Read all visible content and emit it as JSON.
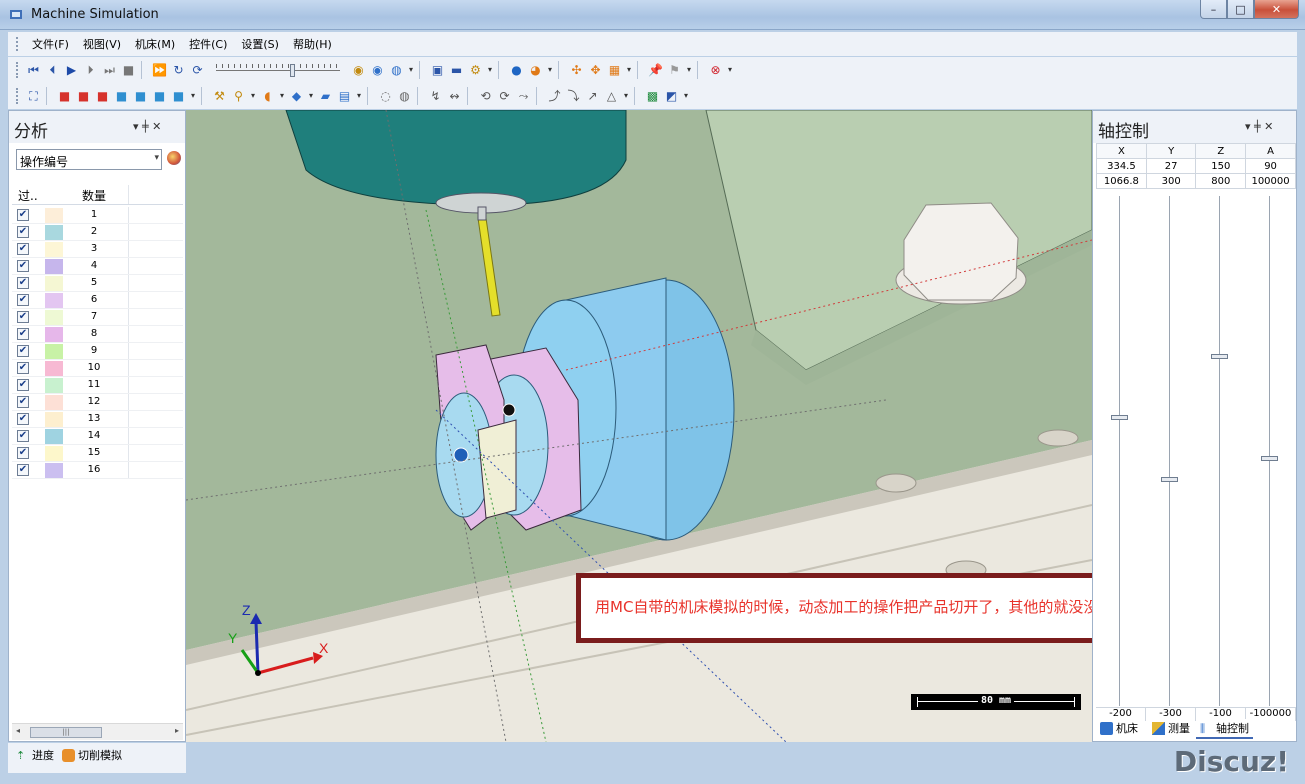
{
  "window": {
    "title": "Machine Simulation",
    "min": "–",
    "max": "□",
    "close": "✕"
  },
  "menu": [
    "文件(F)",
    "视图(V)",
    "机床(M)",
    "控件(C)",
    "设置(S)",
    "帮助(H)"
  ],
  "analysis_panel": {
    "title": "分析",
    "pin": "▾ ╪ ✕",
    "combo_value": "操作编号",
    "col_filter": "过..",
    "col_count": "数量",
    "rows": [
      {
        "n": "1",
        "color": "#fdeed9"
      },
      {
        "n": "2",
        "color": "#a9d8df"
      },
      {
        "n": "3",
        "color": "#fdf6d6"
      },
      {
        "n": "4",
        "color": "#c6b6ec"
      },
      {
        "n": "5",
        "color": "#f5f7d3"
      },
      {
        "n": "6",
        "color": "#e3c6f1"
      },
      {
        "n": "7",
        "color": "#eef9d4"
      },
      {
        "n": "8",
        "color": "#e6b7ea"
      },
      {
        "n": "9",
        "color": "#c8f2a6"
      },
      {
        "n": "10",
        "color": "#f7b9d3"
      },
      {
        "n": "11",
        "color": "#c8f1cf"
      },
      {
        "n": "12",
        "color": "#fde0d6"
      },
      {
        "n": "13",
        "color": "#fdefcf"
      },
      {
        "n": "14",
        "color": "#9fd3e1"
      },
      {
        "n": "15",
        "color": "#fdf7cb"
      },
      {
        "n": "16",
        "color": "#cbbff0"
      }
    ]
  },
  "bottom_tabs": {
    "progress": "进度",
    "cut_sim": "切削模拟"
  },
  "axis_panel": {
    "title": "轴控制",
    "pin": "▾ ╪ ✕",
    "headers": [
      "X",
      "Y",
      "Z",
      "A"
    ],
    "current": [
      "334.5",
      "27",
      "150",
      "90"
    ],
    "max": [
      "1066.8",
      "300",
      "800",
      "100000"
    ],
    "min": [
      "-200",
      "-300",
      "-100",
      "-100000"
    ],
    "levels": [
      0.57,
      0.45,
      0.69,
      0.49
    ]
  },
  "right_tabs": {
    "machine": "机床",
    "measure": "测量",
    "axis": "轴控制"
  },
  "viewport": {
    "annotation": "用MC自带的机床模拟的时候，动态加工的操作把产品切开了，其他的就没没问题",
    "scale_label": "80 mm",
    "triad": {
      "x": "X",
      "y": "Y",
      "z": "Z"
    }
  },
  "watermark": "Discuz!",
  "colors": {
    "accent": "#4169b5",
    "annotation_text": "#e8332b",
    "annotation_border": "#7a1c1c"
  }
}
